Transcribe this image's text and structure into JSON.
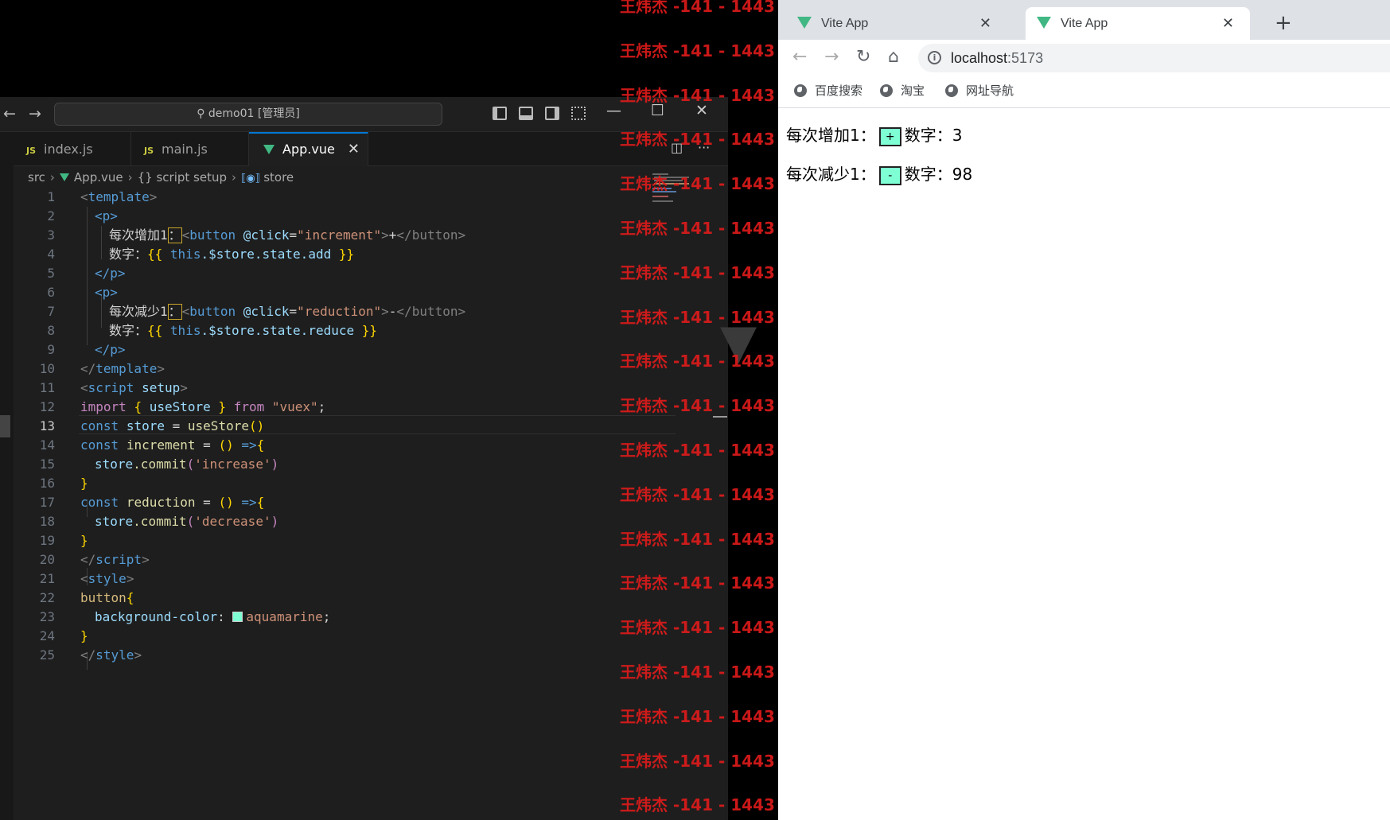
{
  "vscode": {
    "search_text": "demo01 [管理员]",
    "tabs": [
      {
        "label": "index.js",
        "badge": "JS"
      },
      {
        "label": "main.js",
        "badge": "JS"
      },
      {
        "label": "App.vue",
        "badge": "vue"
      }
    ],
    "breadcrumb": {
      "folder": "src",
      "file": "App.vue",
      "scope_icon": "{}",
      "scope": "script setup",
      "symbol": "store"
    },
    "current_line": 13,
    "line_numbers": [
      "1",
      "2",
      "3",
      "4",
      "5",
      "6",
      "7",
      "8",
      "9",
      "10",
      "11",
      "12",
      "13",
      "14",
      "15",
      "16",
      "17",
      "18",
      "19",
      "20",
      "21",
      "22",
      "23",
      "24",
      "25"
    ],
    "code": {
      "l1_open": "<",
      "l1_tag": "template",
      "l1_close": ">",
      "l2": "<p>",
      "l3_text": "每次增加1",
      "l3_colon": "：",
      "l3_open": "<",
      "l3_tag": "button",
      "l3_attr": "@click",
      "l3_eq": "=",
      "l3_val": "\"increment\"",
      "l3_gt": ">",
      "l3_content": "+",
      "l3_end": "</button>",
      "l4_text": "数字：",
      "l4_ob": "{{",
      "l4_this": "this",
      "l4_path": ".$store.state.add",
      "l4_cb": "}}",
      "l5": "</p>",
      "l6": "<p>",
      "l7_text": "每次减少1",
      "l7_colon": "：",
      "l7_open": "<",
      "l7_tag": "button",
      "l7_attr": "@click",
      "l7_eq": "=",
      "l7_val": "\"reduction\"",
      "l7_gt": ">",
      "l7_content": "-",
      "l7_end": "</button>",
      "l8_text": "数字：",
      "l8_ob": "{{",
      "l8_this": "this",
      "l8_path": ".$store.state.reduce",
      "l8_cb": "}}",
      "l9": "</p>",
      "l10_open": "</",
      "l10_tag": "template",
      "l10_close": ">",
      "l11_open": "<",
      "l11_tag": "script",
      "l11_attr": "setup",
      "l11_close": ">",
      "l12_import": "import",
      "l12_ob": "{",
      "l12_name": "useStore",
      "l12_cb": "}",
      "l12_from": "from",
      "l12_str": "\"vuex\"",
      "l12_semi": ";",
      "l13_const": "const",
      "l13_var": "store",
      "l13_eq": "=",
      "l13_fn": "useStore",
      "l13_par": "()",
      "l14_const": "const",
      "l14_var": "increment",
      "l14_eq": "=",
      "l14_par": "()",
      "l14_arrow": "=>",
      "l14_brace": "{",
      "l15_obj": "store",
      "l15_fn": ".commit",
      "l15_op": "(",
      "l15_str": "'increase'",
      "l15_cp": ")",
      "l16": "}",
      "l17_const": "const",
      "l17_var": "reduction",
      "l17_eq": "=",
      "l17_par": "()",
      "l17_arrow": "=>",
      "l17_brace": "{",
      "l18_obj": "store",
      "l18_fn": ".commit",
      "l18_op": "(",
      "l18_str": "'decrease'",
      "l18_cp": ")",
      "l19": "}",
      "l20_open": "</",
      "l20_tag": "script",
      "l20_close": ">",
      "l21_open": "<",
      "l21_tag": "style",
      "l21_close": ">",
      "l22_sel": "button",
      "l22_brace": "{",
      "l23_prop": "background-color",
      "l23_colon": ":",
      "l23_val": "aquamarine",
      "l23_semi": ";",
      "l24": "}",
      "l25_open": "</",
      "l25_tag": "style",
      "l25_close": ">"
    },
    "swatch_color": "#7fffd4"
  },
  "watermark": {
    "text": "王炜杰 -141 - 1443",
    "color": "#e01b1b"
  },
  "chrome": {
    "tabs": [
      {
        "title": "Vite App"
      },
      {
        "title": "Vite App"
      }
    ],
    "url_host": "localhost",
    "url_port": ":5173",
    "bookmarks": [
      "百度搜索",
      "淘宝",
      "网址导航"
    ],
    "page": {
      "row1_label": "每次增加1：",
      "row1_button": "+",
      "row1_count_label": "数字：",
      "row1_count": "3",
      "row2_label": "每次减少1：",
      "row2_button": "-",
      "row2_count_label": "数字：",
      "row2_count": "98",
      "button_color": "#7fffd4"
    }
  },
  "icons": [
    "arrow-left-icon",
    "arrow-right-icon",
    "search-icon",
    "vue-logo-icon",
    "js-file-icon",
    "reload-icon",
    "home-icon",
    "info-icon",
    "globe-icon",
    "close-icon",
    "plus-icon",
    "split-editor-icon",
    "more-icon",
    "minimize-icon",
    "maximize-icon"
  ]
}
